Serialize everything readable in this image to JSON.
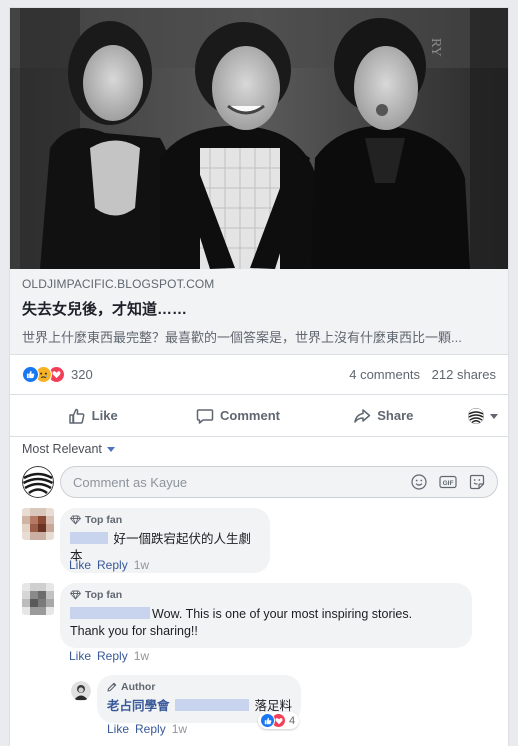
{
  "link_preview": {
    "domain": "OLDJIMPACIFIC.BLOGSPOT.COM",
    "title": "失去女兒後，才知道……",
    "description": "世界上什麼東西最完整？最喜歡的一個答案是，世界上沒有什麼東西比一顆..."
  },
  "stats": {
    "reaction_count": "320",
    "comments": "4 comments",
    "shares": "212 shares",
    "reaction_types": [
      "like",
      "sad",
      "love"
    ]
  },
  "actions": {
    "like": "Like",
    "comment": "Comment",
    "share": "Share"
  },
  "sort": {
    "label": "Most Relevant"
  },
  "composer": {
    "placeholder": "Comment as Kayue"
  },
  "comments": [
    {
      "badge": "Top fan",
      "text": "好一個跌宕起伏的人生劇本",
      "like": "Like",
      "reply": "Reply",
      "time": "1w"
    },
    {
      "badge": "Top fan",
      "text_line1": "Wow. This is one of your most inspiring stories.",
      "text_line2": "Thank you for sharing!!",
      "like": "Like",
      "reply": "Reply",
      "time": "1w"
    }
  ],
  "reply": {
    "badge": "Author",
    "author": "老占同學會",
    "text": "落足料",
    "reaction_count": "4",
    "like": "Like",
    "reply": "Reply",
    "time": "1w"
  },
  "colors": {
    "facebook_blue": "#1877f2",
    "link_blue": "#385898",
    "bubble_gray": "#f2f3f5"
  }
}
